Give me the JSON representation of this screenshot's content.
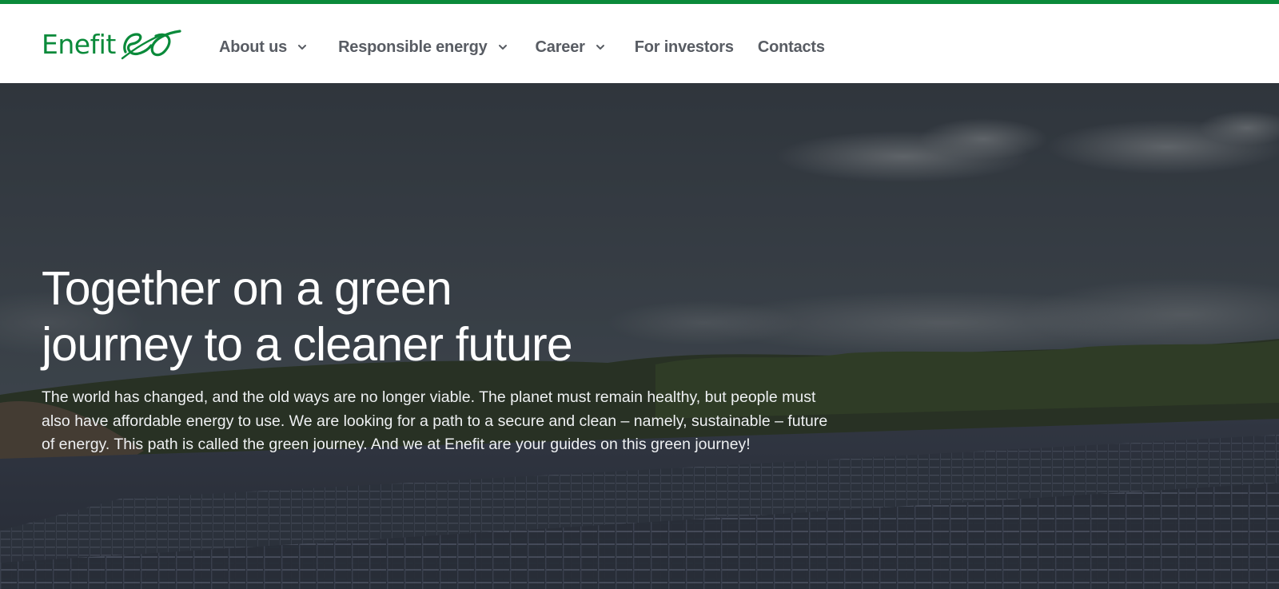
{
  "brand": {
    "name": "Enefit",
    "accent_color": "#0a8a3a"
  },
  "nav": {
    "items": [
      {
        "label": "About us",
        "has_dropdown": true
      },
      {
        "label": "Responsible energy",
        "has_dropdown": true
      },
      {
        "label": "Career",
        "has_dropdown": true
      },
      {
        "label": "For investors",
        "has_dropdown": false
      },
      {
        "label": "Contacts",
        "has_dropdown": false
      }
    ],
    "text_color": "#585c63"
  },
  "hero": {
    "title_line1": "Together on a green",
    "title_line2": "journey to a cleaner future",
    "body": "The world has changed, and the old ways are no longer viable. The planet must remain healthy, but people must also have affordable energy to use. We are looking for a path to a secure and clean – namely, sustainable – future of energy. This path is called the green journey. And we at Enefit are your guides on this green journey!",
    "background": "solar-farm-landscape"
  }
}
